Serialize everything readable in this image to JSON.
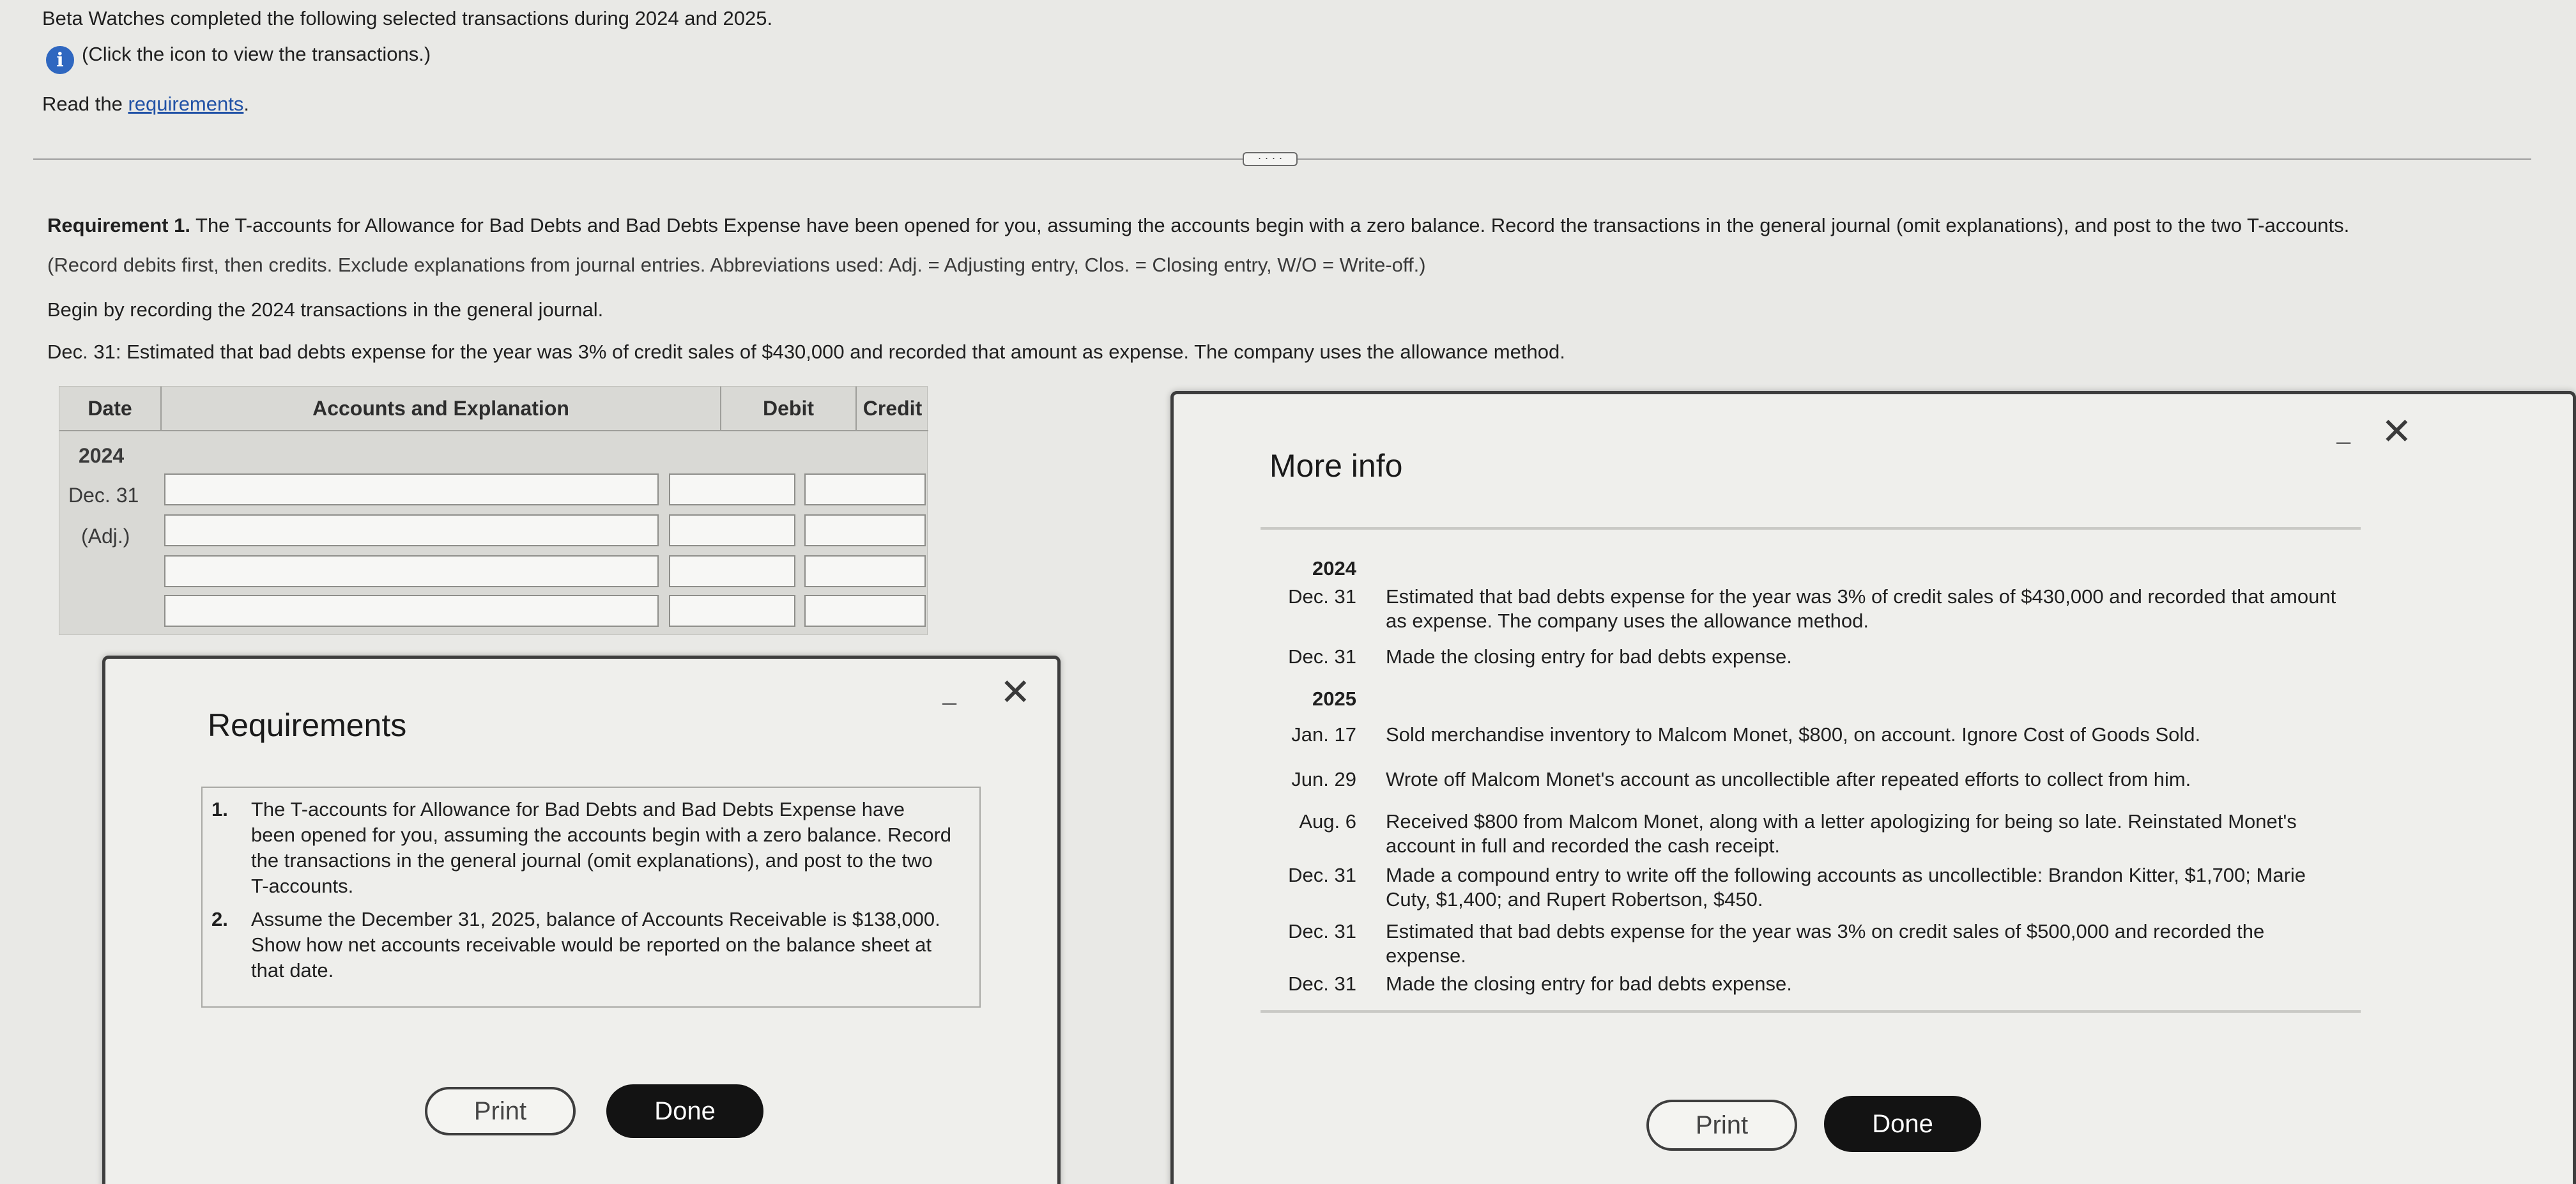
{
  "intro": {
    "line1": "Beta Watches completed the following selected transactions during 2024 and 2025.",
    "click_text": "(Click the icon to view the transactions.)",
    "read_prefix": "Read the ",
    "requirements_link": "requirements",
    "read_suffix": "."
  },
  "handle_label": "· · · ·",
  "requirement1": {
    "bold_label": "Requirement 1.",
    "text": " The T-accounts for Allowance for Bad Debts and Bad Debts Expense have been opened for you, assuming the accounts begin with a zero balance. Record the transactions in the general journal (omit explanations), and post to the two T-accounts.",
    "note": "(Record debits first, then credits. Exclude explanations from journal entries. Abbreviations used: Adj. = Adjusting entry, Clos. = Closing entry, W/O = Write-off.)",
    "begin": "Begin by recording the 2024 transactions in the general journal.",
    "dec31_prefix": "Dec. 31:",
    "dec31_text": " Estimated that bad debts expense for the year was 3% of credit sales of $430,000 and recorded that amount as expense. The company uses the allowance method."
  },
  "journal": {
    "headers": {
      "date": "Date",
      "accounts": "Accounts and Explanation",
      "debit": "Debit",
      "credit": "Credit"
    },
    "year": "2024",
    "date": "Dec. 31",
    "tag": "(Adj.)"
  },
  "requirements_dialog": {
    "title": "Requirements",
    "items": [
      {
        "num": "1.",
        "text": "The T-accounts for Allowance for Bad Debts and Bad Debts Expense have been opened for you, assuming the accounts begin with a zero balance. Record the transactions in the general journal (omit explanations), and post to the two T-accounts."
      },
      {
        "num": "2.",
        "text": "Assume the December 31, 2025, balance of Accounts Receivable is $138,000. Show how net accounts receivable would be reported on the balance sheet at that date."
      }
    ],
    "print": "Print",
    "done": "Done",
    "minimize": "–",
    "close": "✕"
  },
  "more_info_dialog": {
    "title": "More info",
    "rows": [
      {
        "year": "2024"
      },
      {
        "date": "Dec. 31",
        "text": "Estimated that bad debts expense for the year was 3% of credit sales of $430,000 and recorded that amount as expense. The company uses the allowance method."
      },
      {
        "date": "Dec. 31",
        "text": "Made the closing entry for bad debts expense."
      },
      {
        "year": "2025"
      },
      {
        "date": "Jan. 17",
        "text": "Sold merchandise inventory to Malcom Monet, $800, on account. Ignore Cost of Goods Sold."
      },
      {
        "date": "Jun. 29",
        "text": "Wrote off Malcom Monet's account as uncollectible after repeated efforts to collect from him."
      },
      {
        "date": "Aug. 6",
        "text": "Received $800 from Malcom Monet, along with a letter apologizing for being so late. Reinstated Monet's account in full and recorded the cash receipt."
      },
      {
        "date": "Dec. 31",
        "text": "Made a compound entry to write off the following accounts as uncollectible: Brandon Kitter, $1,700; Marie Cuty, $1,400; and Rupert Robertson, $450."
      },
      {
        "date": "Dec. 31",
        "text": "Estimated that bad debts expense for the year was 3% on credit sales of $500,000 and recorded the expense."
      },
      {
        "date": "Dec. 31",
        "text": "Made the closing entry for bad debts expense."
      }
    ],
    "print": "Print",
    "done": "Done",
    "minimize": "–",
    "close": "✕"
  }
}
